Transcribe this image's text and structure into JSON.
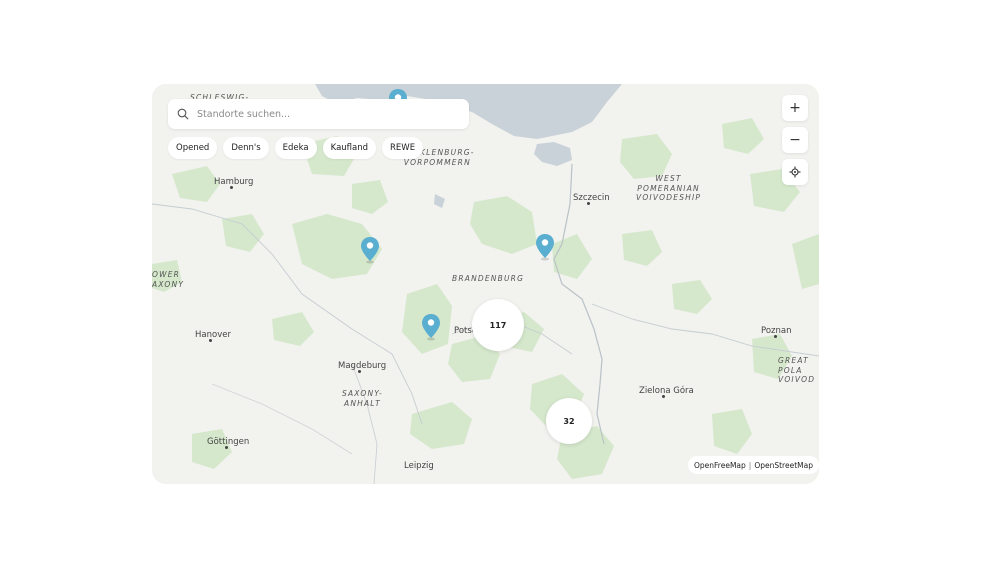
{
  "search": {
    "placeholder": "Standorte suchen..."
  },
  "filters": [
    "Opened",
    "Denn's",
    "Edeka",
    "Kaufland",
    "REWE"
  ],
  "controls": {
    "zoom_in": "+",
    "zoom_out": "−"
  },
  "cities": {
    "hamburg": "Hamburg",
    "szczecin": "Szczecin",
    "hanover": "Hanover",
    "magdeburg": "Magdeburg",
    "potsdam": "Potsd",
    "poznan": "Poznan",
    "zielona_gora": "Zielona Góra",
    "gottingen": "Göttingen",
    "leipzig": "Leipzig"
  },
  "regions": {
    "schleswig": "SCHLESWIG-",
    "mecklenburg": "MECKLENBURG-\nVORPOMMERN",
    "west_pomeranian": "WEST\nPOMERANIAN\nVOIVODESHIP",
    "brandenburg": "BRANDENBURG",
    "lower_saxony": "OWER\nAXONY",
    "saxony_anhalt": "SAXONY-\nANHALT",
    "greater_poland": "GREAT\nPOLA\nVOIVOD"
  },
  "clusters": {
    "a": "117",
    "b": "32"
  },
  "attribution": {
    "a": "OpenFreeMap",
    "separator": "|",
    "b": "OpenStreetMap"
  },
  "colors": {
    "pin": "#5aaed0",
    "water": "#c9d2d8",
    "forest": "#d5e8cc",
    "land": "#f2f2ef"
  }
}
